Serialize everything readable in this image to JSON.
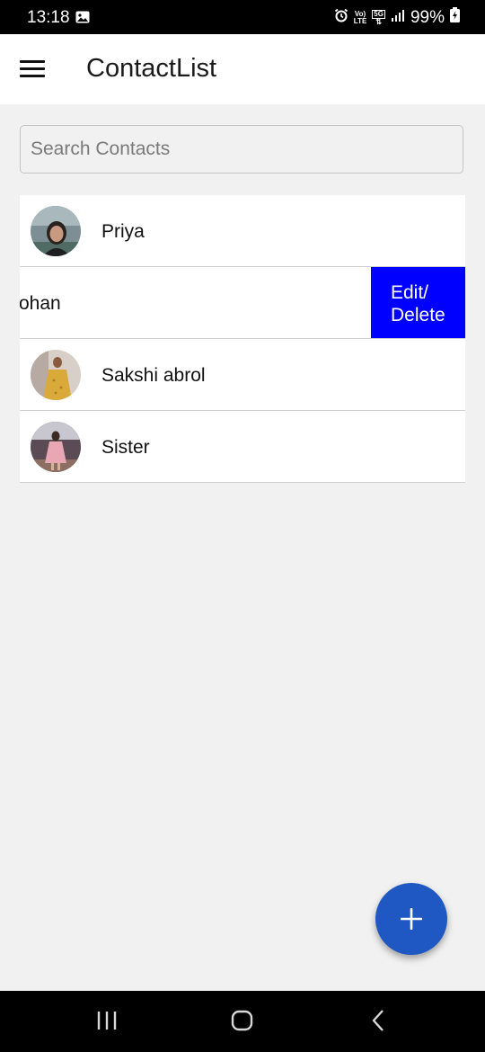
{
  "status_bar": {
    "time": "13:18",
    "volte_line1": "Vo)",
    "volte_line2": "LTE",
    "network": "5G",
    "battery": "99%"
  },
  "app_bar": {
    "title": "ContactList",
    "menu_icon": "hamburger-menu-icon"
  },
  "search": {
    "placeholder": "Search Contacts",
    "value": ""
  },
  "contacts": [
    {
      "name": "Priya",
      "avatar": "photo"
    },
    {
      "name": "ohan",
      "swiped": true,
      "action_label_line1": "Edit/",
      "action_label_line2": "Delete"
    },
    {
      "name": "Sakshi abrol",
      "avatar": "photo"
    },
    {
      "name": "Sister",
      "avatar": "photo"
    }
  ],
  "fab": {
    "icon": "plus-icon"
  },
  "nav_bar": {
    "icons": [
      "recent-apps-icon",
      "home-icon",
      "back-icon"
    ]
  },
  "colors": {
    "action_blue": "#0000ff",
    "fab_blue": "#1f57c3",
    "background": "#f1f1f1"
  }
}
